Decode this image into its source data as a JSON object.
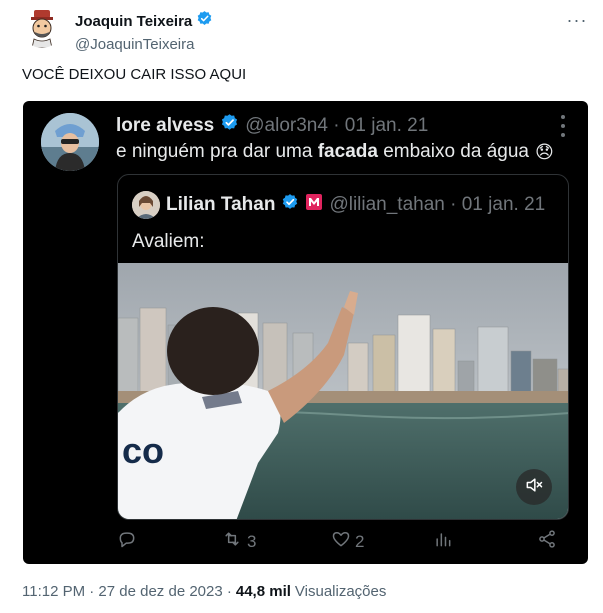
{
  "author": {
    "display_name": "Joaquin Teixeira",
    "handle": "@JoaquinTeixeira",
    "verified": true
  },
  "tweet": {
    "text": "VOCÊ DEIXOU CAIR ISSO AQUI"
  },
  "embedded": {
    "author_name": "lore alvess",
    "author_meta": "@alor3n4 · 01 jan. 21",
    "text_before": "e ninguém pra dar uma ",
    "text_bold": "facada",
    "text_after": " embaixo da água",
    "emoji": "😞",
    "quote": {
      "author_name": "Lilian Tahan",
      "author_meta": "@lilian_tahan · 01 jan. 21",
      "text": "Avaliem:"
    },
    "actions": {
      "retweets": "3",
      "likes": "2"
    }
  },
  "footer": {
    "timestamp": "11:12 PM · 27 de dez de 2023 ·",
    "views_count": "44,8 mil",
    "views_label": "Visualizações"
  },
  "colors": {
    "verified_blue": "#1d9bf0",
    "embed_bg": "#000000",
    "muted_text": "#536471"
  }
}
